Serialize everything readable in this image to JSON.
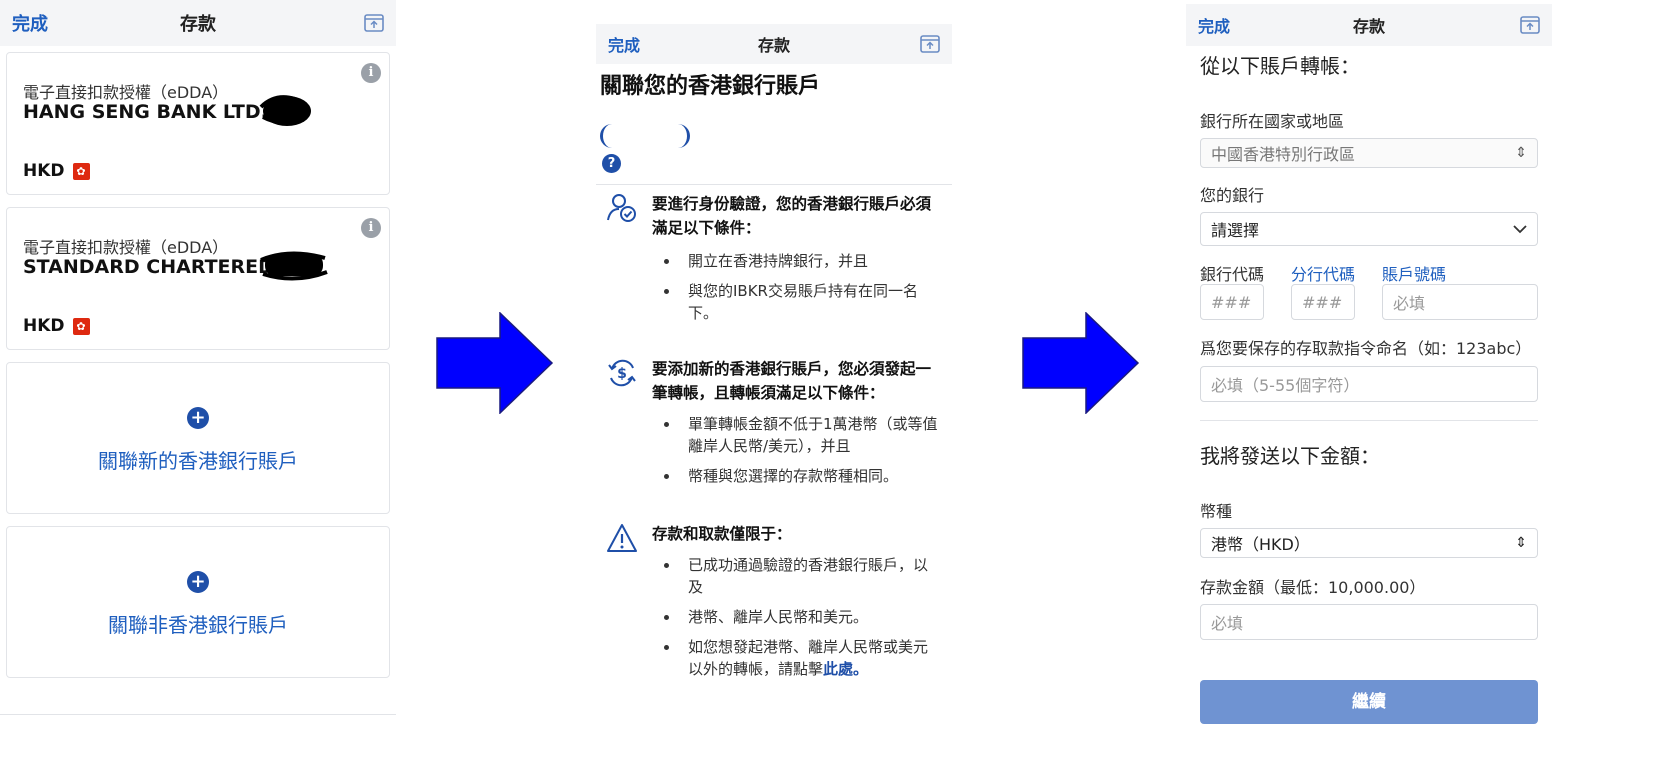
{
  "colors": {
    "accent": "#1f5fbf",
    "arrow": "#0000ff",
    "button": "#6f93d2"
  },
  "panel1": {
    "nav": {
      "done": "完成",
      "title": "存款",
      "icon": "share-screen-icon"
    },
    "cards": [
      {
        "type": "電子直接扣款授權（eDDA）",
        "bank": "HANG SENG BANK LTD...",
        "currency": "HKD"
      },
      {
        "type": "電子直接扣款授權（eDDA）",
        "bank": "STANDARD CHARTERED..",
        "currency": "HKD"
      }
    ],
    "add_hk": "關聯新的香港銀行賬戶",
    "add_non_hk": "關聯非香港銀行賬戶"
  },
  "panel2": {
    "nav": {
      "done": "完成",
      "title": "存款"
    },
    "heading": "關聯您的香港銀行賬戶",
    "help": "?",
    "sections": [
      {
        "icon": "user-check-icon",
        "title": "要進行身份驗證，您的香港銀行賬戶必須滿足以下條件：",
        "bullets": [
          "開立在香港持牌銀行，并且",
          "與您的IBKR交易賬戶持有在同一名下。"
        ]
      },
      {
        "icon": "currency-exchange-icon",
        "title": "要添加新的香港銀行賬戶，您必須發起一筆轉帳，且轉帳須滿足以下條件：",
        "bullets": [
          "單筆轉帳金額不低于1萬港幣（或等值離岸人民幣/美元），并且",
          "幣種與您選擇的存款幣種相同。"
        ]
      },
      {
        "icon": "warning-icon",
        "title": "存款和取款僅限于：",
        "bullets": [
          "已成功通過驗證的香港銀行賬戶，以及",
          "港幣、離岸人民幣和美元。"
        ],
        "last_prefix": "如您想發起港幣、離岸人民幣或美元以外的轉帳，請點擊",
        "last_link": "此處。"
      }
    ]
  },
  "panel3": {
    "nav": {
      "done": "完成",
      "title": "存款"
    },
    "from_heading": "從以下賬戶轉帳：",
    "country_label": "銀行所在國家或地區",
    "country_value": "中國香港特別行政區",
    "bank_label": "您的銀行",
    "bank_value": "請選擇",
    "bank_code_label": "銀行代碼",
    "branch_code_label": "分行代碼",
    "account_no_label": "賬戶號碼",
    "bank_code_ph": "###",
    "branch_code_ph": "###",
    "account_no_ph": "必填",
    "instruction_label": "爲您要保存的存取款指令命名（如：123abc）",
    "instruction_ph": "必填（5-55個字符）",
    "amount_heading": "我將發送以下金額：",
    "currency_label": "幣種",
    "currency_value": "港幣（HKD）",
    "amount_label": "存款金額（最低：10,000.00）",
    "amount_ph": "必填",
    "continue": "繼續"
  }
}
